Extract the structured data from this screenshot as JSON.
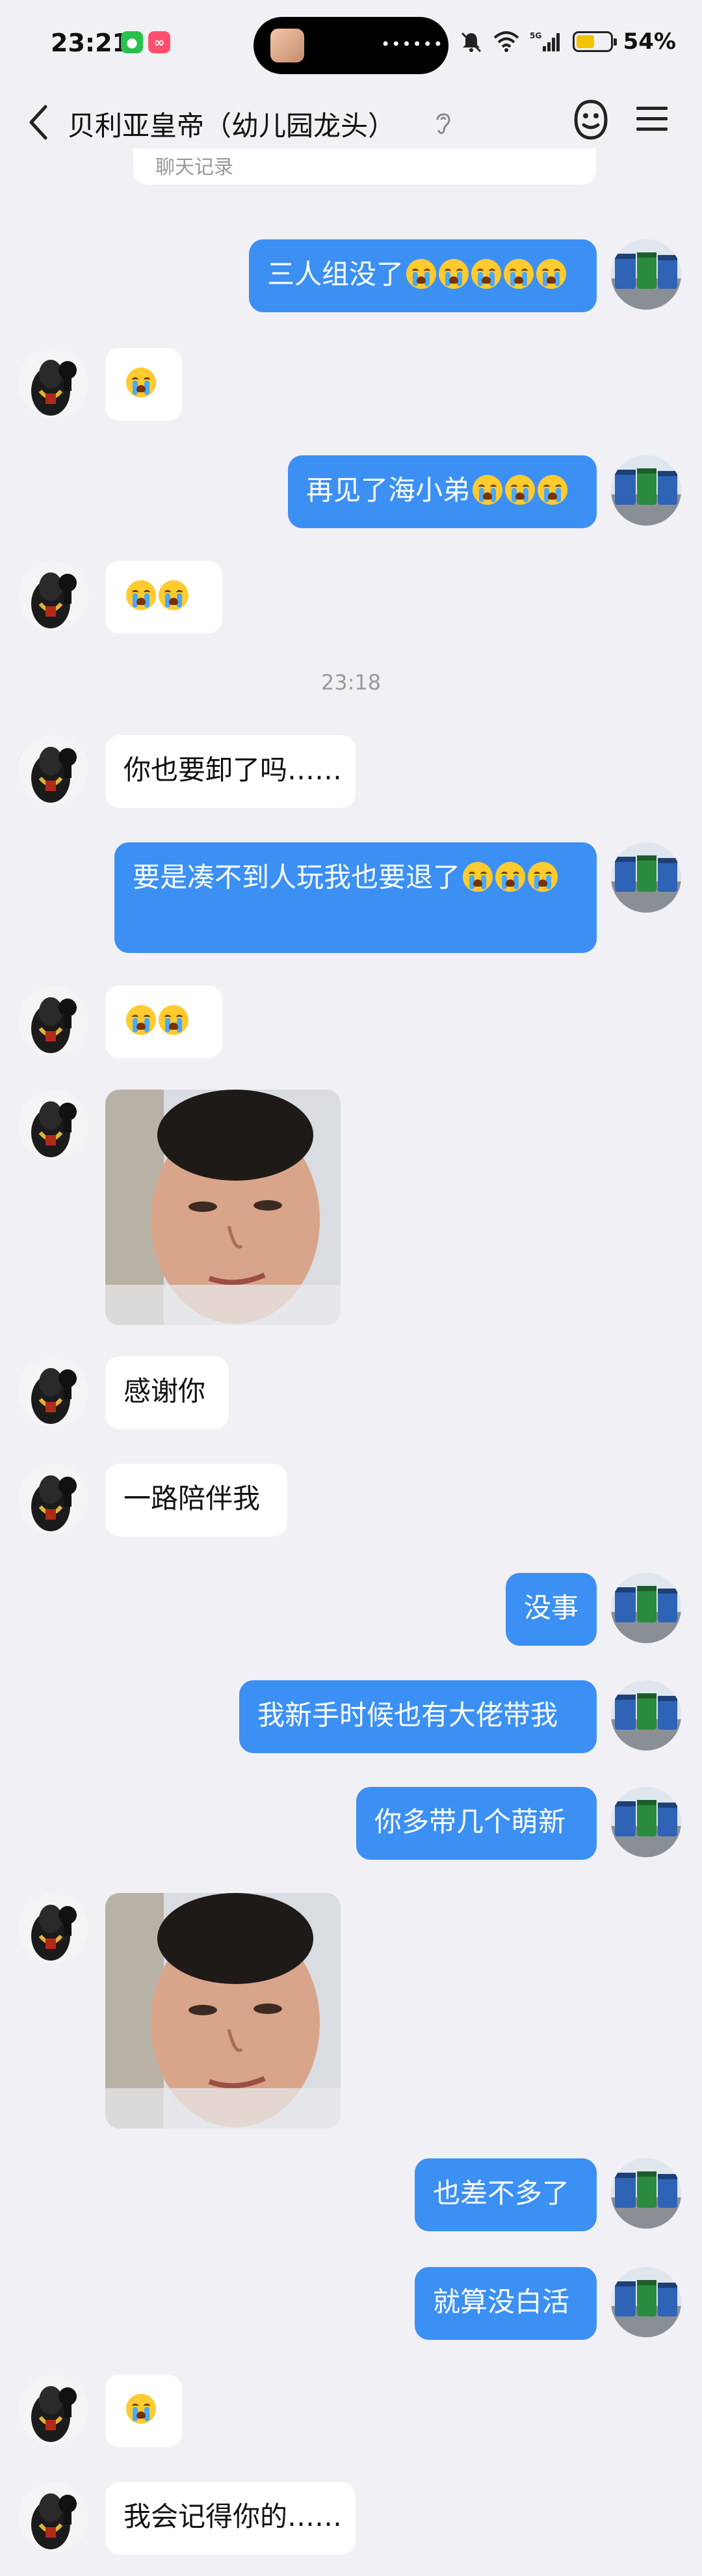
{
  "status_bar": {
    "time": "23:21",
    "battery": "54%",
    "battery_level": 0.54,
    "network": "5G"
  },
  "header": {
    "title": "贝利亚皇帝（幼儿园龙头）",
    "search_card_text": "聊天记录"
  },
  "colors": {
    "bubble_right": "#3c90f4",
    "bubble_left": "#ffffff",
    "background": "#f0f0f5"
  },
  "timestamp": "23:18",
  "messages": [
    {
      "side": "right",
      "text": "三人组没了",
      "emoji_count": 5
    },
    {
      "side": "left",
      "text": "",
      "emoji_count": 1
    },
    {
      "side": "right",
      "text": "再见了海小弟",
      "emoji_count": 3
    },
    {
      "side": "left",
      "text": "",
      "emoji_count": 2
    },
    {
      "side": "left",
      "text": "你也要卸了吗……",
      "emoji_count": 0
    },
    {
      "side": "right",
      "text": "要是凑不到人玩我也要退了",
      "emoji_count": 3
    },
    {
      "side": "left",
      "text": "",
      "emoji_count": 2
    },
    {
      "side": "left",
      "type": "image",
      "image_name": "selfie-photo"
    },
    {
      "side": "left",
      "text": "感谢你",
      "emoji_count": 0
    },
    {
      "side": "left",
      "text": "一路陪伴我",
      "emoji_count": 0
    },
    {
      "side": "right",
      "text": "没事",
      "emoji_count": 0
    },
    {
      "side": "right",
      "text": "我新手时候也有大佬带我",
      "emoji_count": 0
    },
    {
      "side": "right",
      "text": "你多带几个萌新",
      "emoji_count": 0
    },
    {
      "side": "left",
      "type": "image",
      "image_name": "selfie-photo"
    },
    {
      "side": "right",
      "text": "也差不多了",
      "emoji_count": 0
    },
    {
      "side": "right",
      "text": "就算没白活",
      "emoji_count": 0
    },
    {
      "side": "left",
      "text": "",
      "emoji_count": 1
    },
    {
      "side": "left",
      "text": "我会记得你的……",
      "emoji_count": 0
    }
  ]
}
